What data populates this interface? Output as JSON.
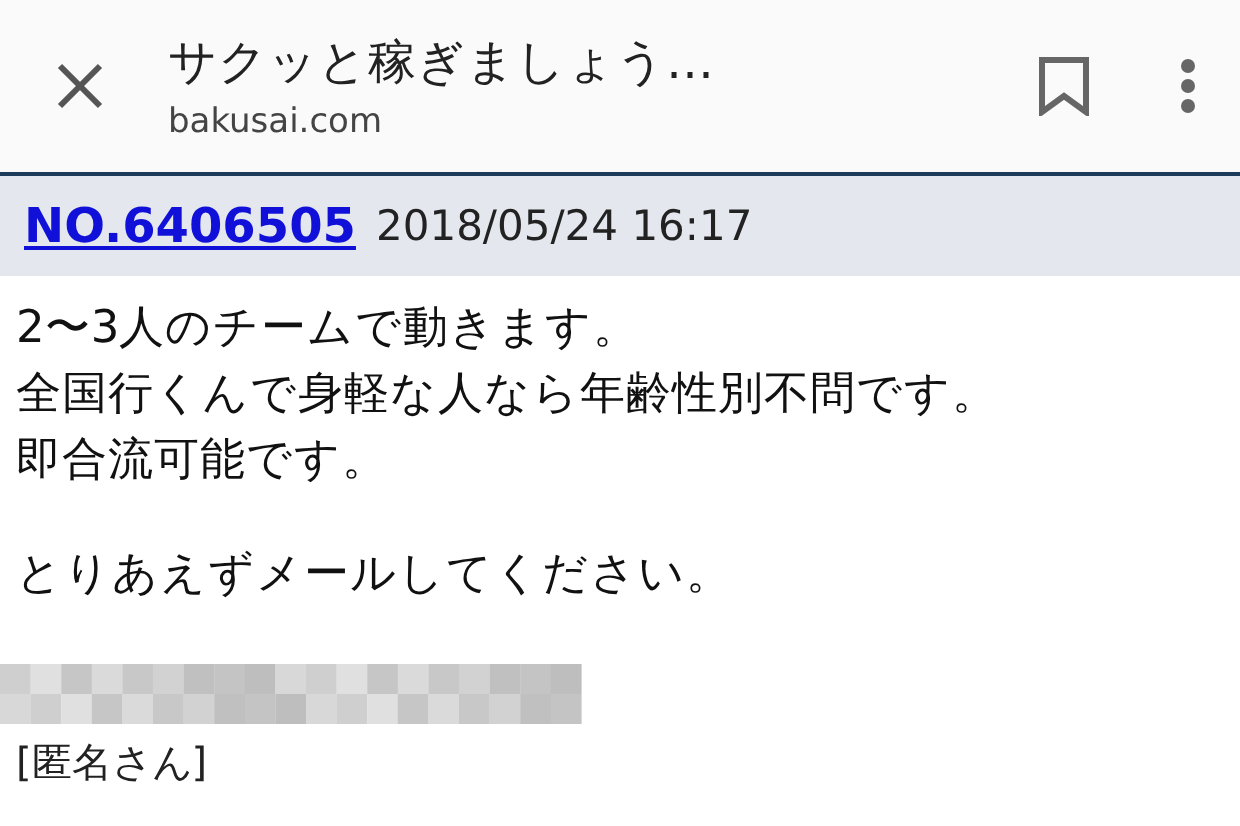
{
  "toolbar": {
    "title": "サクッと稼ぎましょう…",
    "url": "bakusai.com"
  },
  "post": {
    "number": "NO.6406505",
    "date": "2018/05/24 16:17",
    "paragraphs": [
      [
        "2〜3人のチームで動きます。",
        "全国行くんで身軽な人なら年齢性別不問です。",
        "即合流可能です。"
      ],
      [
        "とりあえずメールしてください。"
      ]
    ],
    "author": "[匿名さん]"
  }
}
